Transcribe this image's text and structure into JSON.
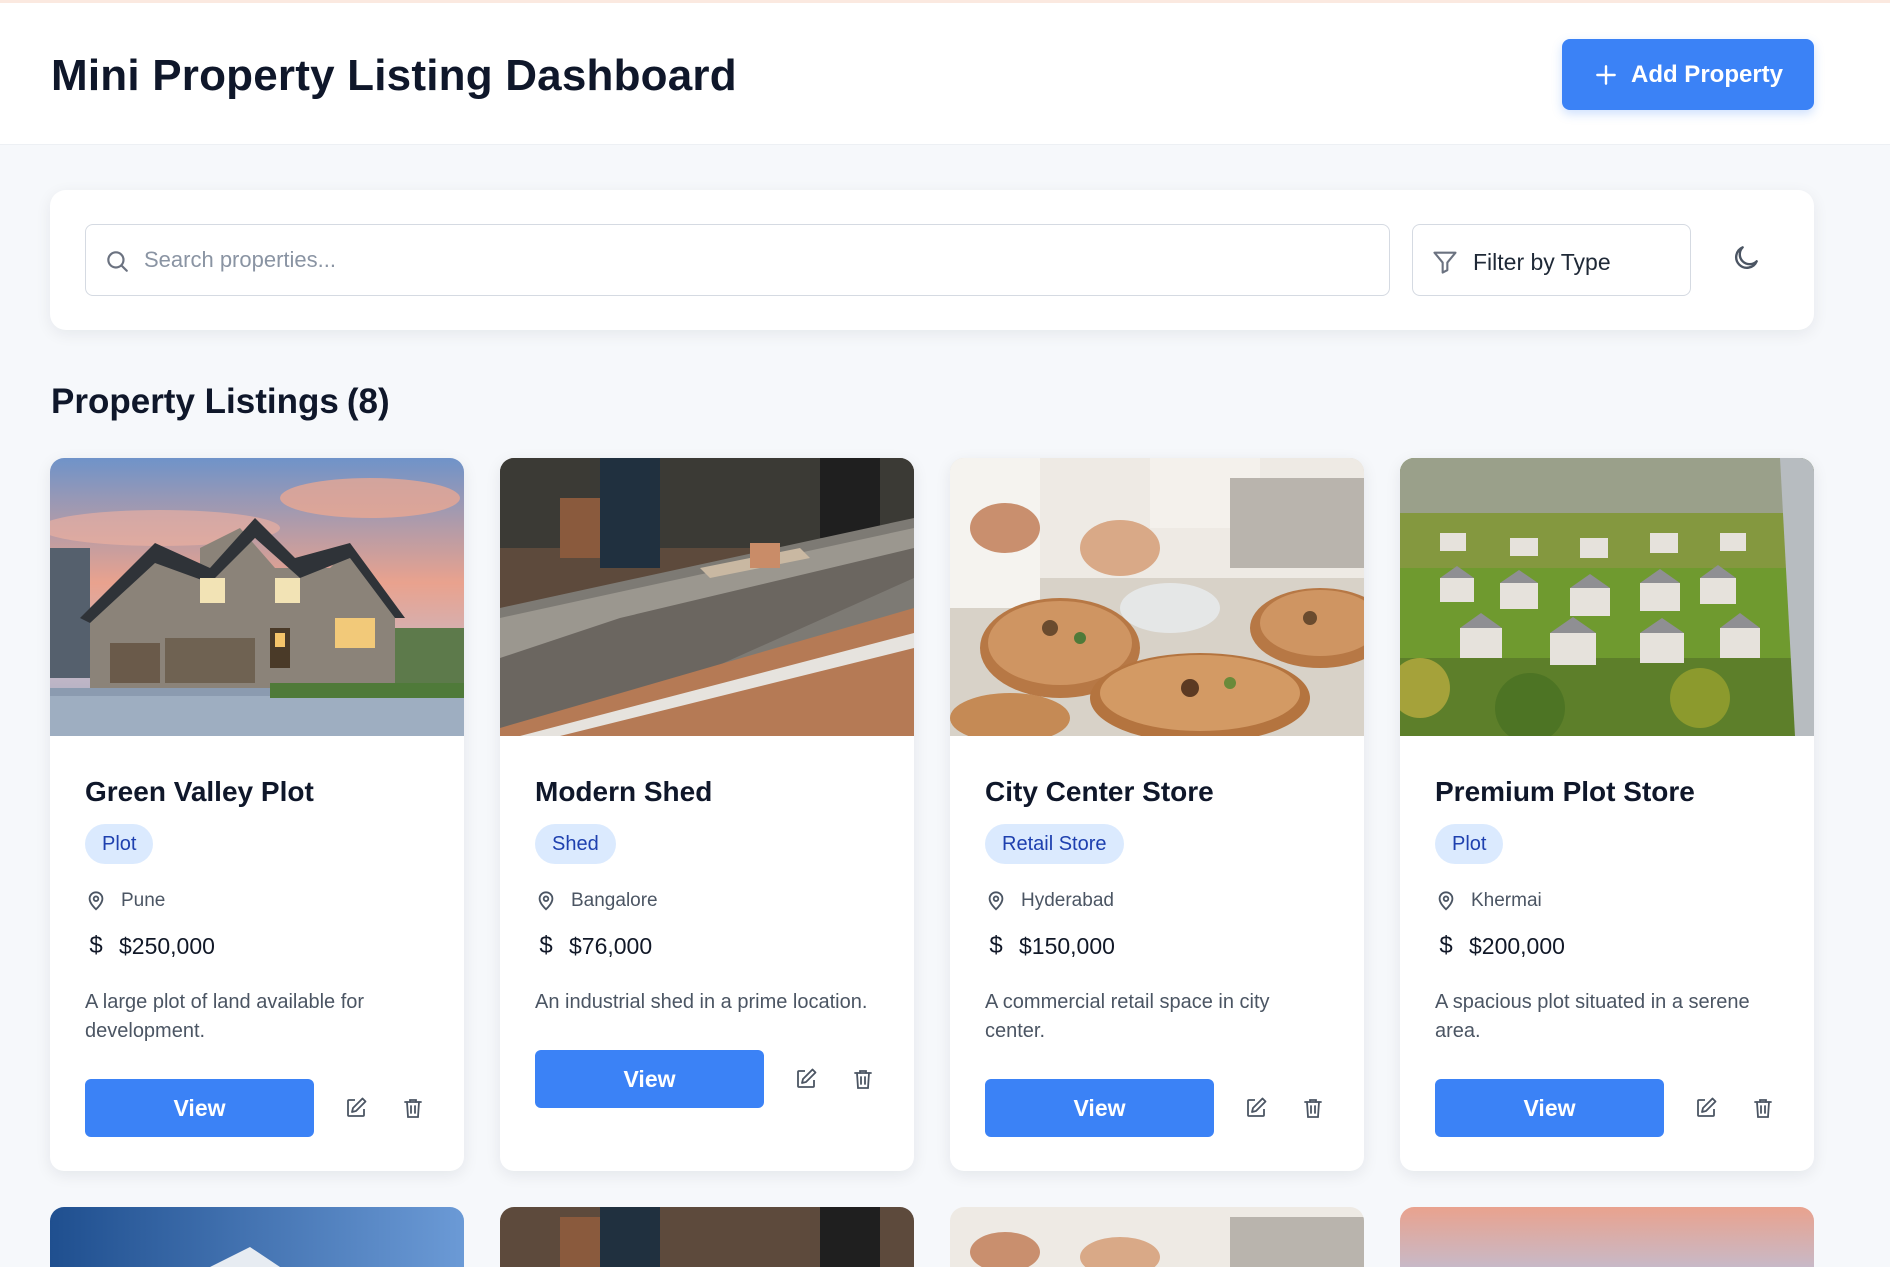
{
  "header": {
    "title": "Mini Property Listing Dashboard",
    "add_button_label": "Add Property"
  },
  "toolbar": {
    "search_placeholder": "Search properties...",
    "search_value": "",
    "filter_label": "Filter by Type"
  },
  "listings": {
    "title": "Property Listings",
    "count": "(8)",
    "view_label": "View",
    "cards": [
      {
        "title": "Green Valley Plot",
        "type": "Plot",
        "location": "Pune",
        "price": "$250,000",
        "description": "A large plot of land available for development.",
        "image": "house-photo"
      },
      {
        "title": "Modern Shed",
        "type": "Shed",
        "location": "Bangalore",
        "price": "$76,000",
        "description": "An industrial shed in a prime location.",
        "image": "construction-photo"
      },
      {
        "title": "City Center Store",
        "type": "Retail Store",
        "location": "Hyderabad",
        "price": "$150,000",
        "description": "A commercial retail space in city center.",
        "image": "food-plating-photo"
      },
      {
        "title": "Premium Plot Store",
        "type": "Plot",
        "location": "Khermai",
        "price": "$200,000",
        "description": "A spacious plot situated in a serene area.",
        "image": "aerial-neighborhood-photo"
      }
    ]
  },
  "colors": {
    "accent": "#3b82f6",
    "badge_bg": "#dbeafe",
    "badge_text": "#1e40af",
    "background": "#f6f8fb"
  }
}
